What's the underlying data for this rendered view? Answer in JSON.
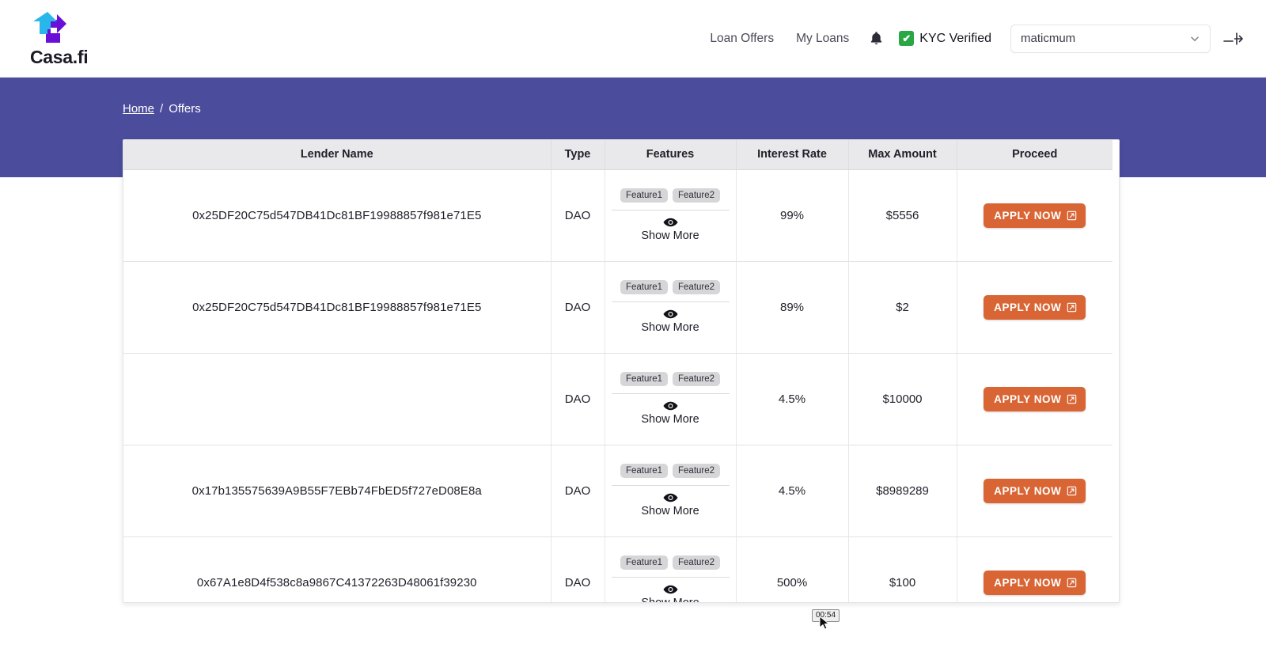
{
  "brand": {
    "name": "Casa.fi",
    "logo_icon": "casafi-arrows-logo",
    "logo_colors": {
      "cyan": "#29b6ea",
      "purple": "#6a0fd6"
    }
  },
  "nav": {
    "links": [
      {
        "label": "Loan Offers",
        "name": "loan-offers"
      },
      {
        "label": "My Loans",
        "name": "my-loans"
      }
    ],
    "notifications_icon": "bell-icon",
    "kyc": {
      "label": "KYC Verified",
      "icon": "green-check-icon",
      "color": "#2aa745",
      "check_glyph": "✔"
    },
    "network": {
      "selected": "maticmum",
      "options": [
        "maticmum"
      ],
      "chevron_icon": "chevron-down-icon"
    },
    "logout": {
      "icon": "logout-icon",
      "label": "Logout"
    }
  },
  "hero": {
    "background_color": "#4c4c9d",
    "breadcrumb": {
      "home_label": "Home",
      "separator": "/",
      "current_label": "Offers"
    }
  },
  "table": {
    "columns": [
      "Lender Name",
      "Type",
      "Features",
      "Interest Rate",
      "Max Amount",
      "Proceed"
    ],
    "show_more_label": "Show More",
    "show_more_icon": "eye-icon",
    "apply_label": "APPLY NOW",
    "apply_icon": "external-link-icon",
    "apply_color": "#d96535",
    "rows": [
      {
        "lender": "0x25DF20C75d547DB41Dc81BF19988857f981e71E5",
        "type": "DAO",
        "features": [
          "Feature1",
          "Feature2"
        ],
        "interest_rate": "99%",
        "max_amount": "$5556"
      },
      {
        "lender": "0x25DF20C75d547DB41Dc81BF19988857f981e71E5",
        "type": "DAO",
        "features": [
          "Feature1",
          "Feature2"
        ],
        "interest_rate": "89%",
        "max_amount": "$2"
      },
      {
        "lender": "",
        "type": "DAO",
        "features": [
          "Feature1",
          "Feature2"
        ],
        "interest_rate": "4.5%",
        "max_amount": "$10000"
      },
      {
        "lender": "0x17b135575639A9B55F7EBb74FbED5f727eD08E8a",
        "type": "DAO",
        "features": [
          "Feature1",
          "Feature2"
        ],
        "interest_rate": "4.5%",
        "max_amount": "$8989289"
      },
      {
        "lender": "0x67A1e8D4f538c8a9867C41372263D48061f39230",
        "type": "DAO",
        "features": [
          "Feature1",
          "Feature2"
        ],
        "interest_rate": "500%",
        "max_amount": "$100"
      }
    ]
  },
  "overlay": {
    "recording_timer": "00:54"
  }
}
